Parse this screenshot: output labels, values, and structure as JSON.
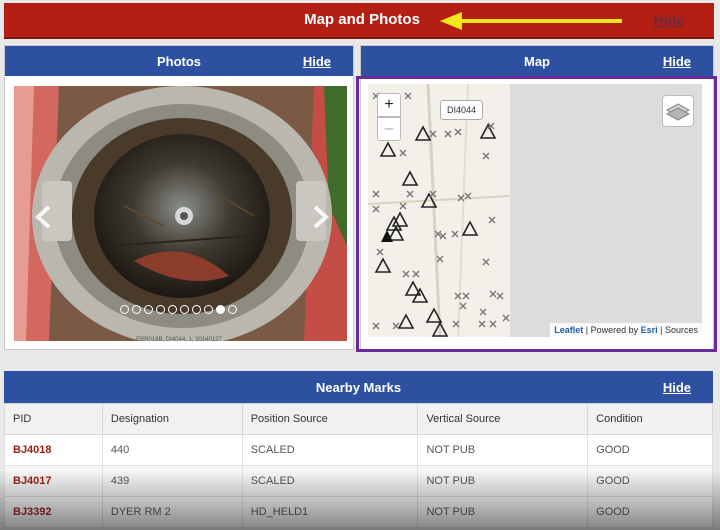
{
  "top_banner": {
    "title": "Map and Photos",
    "hide_label": "Hide"
  },
  "photos": {
    "title": "Photos",
    "hide_label": "Hide",
    "caption": "EBR018B, DI4044, 1, 20140127",
    "slide_count": 10,
    "active_slide": 9,
    "prev_icon": "chevron-left-icon",
    "next_icon": "chevron-right-icon"
  },
  "map": {
    "title": "Map",
    "hide_label": "Hide",
    "zoom_in_label": "+",
    "zoom_out_label": "–",
    "tooltip": "DI4044",
    "attribution": {
      "leaflet": "Leaflet",
      "sep1": " | Powered by ",
      "esri": "Esri",
      "sep2": " | Sources"
    },
    "highlight_color": "#6a2a9e"
  },
  "nearby": {
    "title": "Nearby Marks",
    "hide_label": "Hide",
    "columns": [
      "PID",
      "Designation",
      "Position Source",
      "Vertical Source",
      "Condition"
    ],
    "rows": [
      [
        "BJ4018",
        "440",
        "SCALED",
        "NOT PUB",
        "GOOD"
      ],
      [
        "BJ4017",
        "439",
        "SCALED",
        "NOT PUB",
        "GOOD"
      ],
      [
        "BJ3392",
        "DYER RM 2",
        "HD_HELD1",
        "NOT PUB",
        "GOOD"
      ]
    ]
  },
  "colors": {
    "banner": "#b41f14",
    "header": "#2d51a0",
    "pid_link": "#a01b14",
    "arrow": "#f5e61a"
  }
}
